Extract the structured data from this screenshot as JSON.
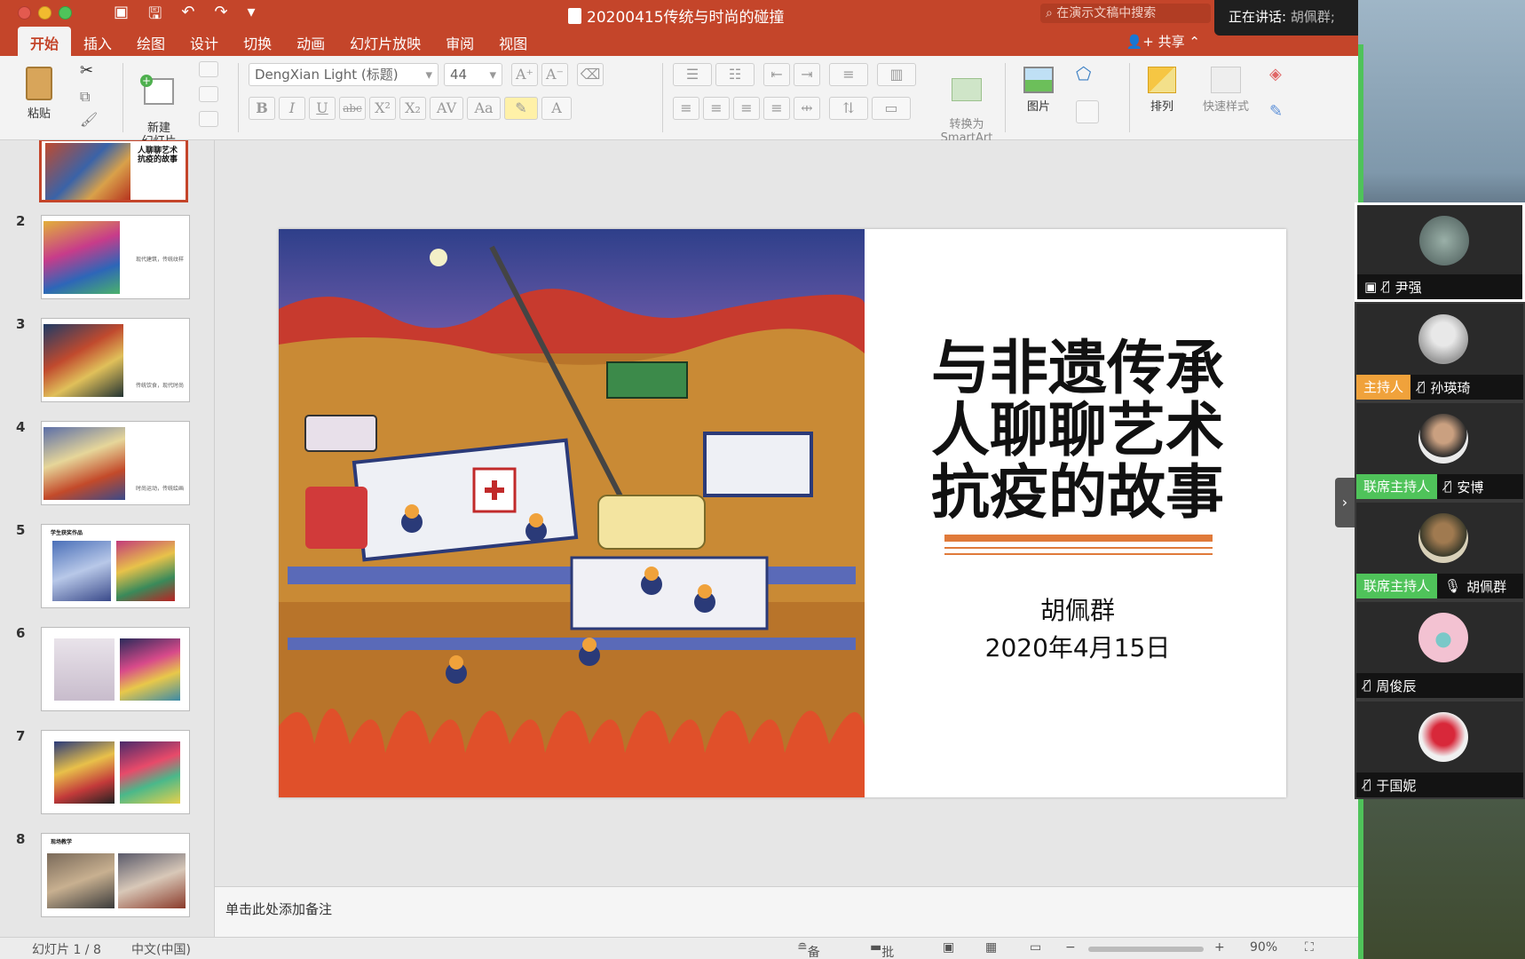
{
  "window": {
    "doc_title": "20200415传统与时尚的碰撞",
    "search_placeholder": "在演示文稿中搜索",
    "share_label": "共享"
  },
  "meeting": {
    "speaking_label": "正在讲话:",
    "speaking_name": "胡佩群;"
  },
  "tabs": [
    "开始",
    "插入",
    "绘图",
    "设计",
    "切换",
    "动画",
    "幻灯片放映",
    "审阅",
    "视图"
  ],
  "ribbon": {
    "paste": "粘贴",
    "new_slide": "新建\n幻灯片",
    "font_name": "DengXian Light (标题)",
    "font_size": "44",
    "convert_smartart": "转换为\nSmartArt",
    "picture": "图片",
    "arrange": "排列",
    "quick_styles": "快速样式",
    "bold": "B",
    "italic": "I",
    "underline": "U",
    "strike": "abc",
    "superscript": "X²",
    "subscript": "X₂"
  },
  "thumbnails": [
    {
      "num": "1",
      "caption": "人聊聊艺术\n抗疫的故事",
      "active": true
    },
    {
      "num": "2",
      "caption": "现代建筑，传统纹样"
    },
    {
      "num": "3",
      "caption": "传统饮食，现代时尚"
    },
    {
      "num": "4",
      "caption": "时尚运动，传统绘画"
    },
    {
      "num": "5",
      "caption": "学生获奖作品"
    },
    {
      "num": "6",
      "caption": ""
    },
    {
      "num": "7",
      "caption": ""
    },
    {
      "num": "8",
      "caption": "现场教学"
    }
  ],
  "slide": {
    "title_line1": "与非遗传承",
    "title_line2": "人聊聊艺术",
    "title_line3": "抗疫的故事",
    "author": "胡佩群",
    "date": "2020年4月15日"
  },
  "notes_placeholder": "单击此处添加备注",
  "status": {
    "slide_count": "幻灯片 1 / 8",
    "language": "中文(中国)",
    "notes": "备注",
    "comments": "批注",
    "zoom": "90%"
  },
  "participants": [
    {
      "name": "尹强",
      "role": "",
      "active": true
    },
    {
      "name": "孙瑛琦",
      "role": "主持人"
    },
    {
      "name": "安博",
      "role": "联席主持人"
    },
    {
      "name": "胡佩群",
      "role": "联席主持人"
    },
    {
      "name": "周俊辰",
      "role": ""
    },
    {
      "name": "于国妮",
      "role": ""
    }
  ],
  "colors": {
    "accent": "#c4452a",
    "host_badge": "#f0a23b",
    "cohost_badge": "#4fc35a",
    "rule": "#e07a3a"
  }
}
